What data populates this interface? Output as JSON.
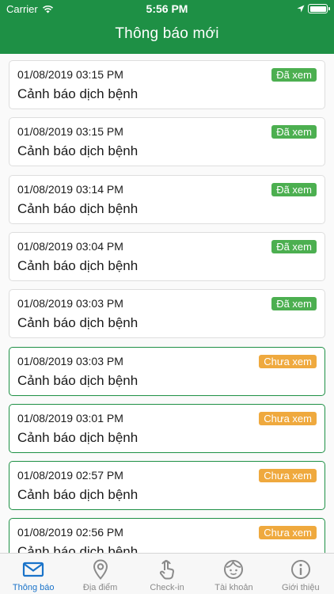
{
  "status_bar": {
    "carrier": "Carrier",
    "time": "5:56 PM"
  },
  "header": {
    "title": "Thông báo mới"
  },
  "badges": {
    "read": "Đã xem",
    "unread": "Chưa xem"
  },
  "colors": {
    "brand_green": "#1e9045",
    "read_badge": "#4caf50",
    "unread_badge": "#efa93e",
    "active_tab": "#1a73c9",
    "inactive_tab": "#8a8a8a"
  },
  "notifications": [
    {
      "date": "01/08/2019 03:15 PM",
      "title": "Cảnh báo dịch bệnh",
      "status": "Đã xem"
    },
    {
      "date": "01/08/2019 03:15 PM",
      "title": "Cảnh báo dịch bệnh",
      "status": "Đã xem"
    },
    {
      "date": "01/08/2019 03:14 PM",
      "title": "Cảnh báo dịch bệnh",
      "status": "Đã xem"
    },
    {
      "date": "01/08/2019 03:04 PM",
      "title": "Cảnh báo dịch bệnh",
      "status": "Đã xem"
    },
    {
      "date": "01/08/2019 03:03 PM",
      "title": "Cảnh báo dịch bệnh",
      "status": "Đã xem"
    },
    {
      "date": "01/08/2019 03:03 PM",
      "title": "Cảnh báo dịch bệnh",
      "status": "Chưa xem"
    },
    {
      "date": "01/08/2019 03:01 PM",
      "title": "Cảnh báo dịch bệnh",
      "status": "Chưa xem"
    },
    {
      "date": "01/08/2019 02:57 PM",
      "title": "Cảnh báo dịch bệnh",
      "status": "Chưa xem"
    },
    {
      "date": "01/08/2019 02:56 PM",
      "title": "Cảnh báo dịch bệnh",
      "status": "Chưa xem"
    }
  ],
  "tabs": [
    {
      "label": "Thông báo",
      "icon": "envelope-icon",
      "active": true
    },
    {
      "label": "Địa điểm",
      "icon": "location-pin-icon",
      "active": false
    },
    {
      "label": "Check-in",
      "icon": "touch-hand-icon",
      "active": false
    },
    {
      "label": "Tài khoản",
      "icon": "face-icon",
      "active": false
    },
    {
      "label": "Giới thiệu",
      "icon": "info-icon",
      "active": false
    }
  ]
}
